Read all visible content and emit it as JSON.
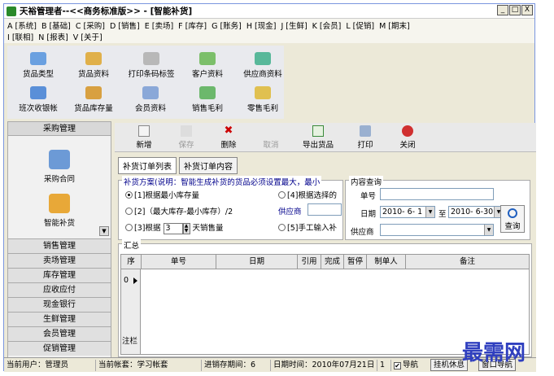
{
  "window": {
    "title": "天裕管理者--<<商务标准版>> - [智能补货]",
    "buttons": [
      "_",
      "□",
      "X"
    ]
  },
  "menu": {
    "row1": [
      "A [系统]",
      "B [基础]",
      "C [采购]",
      "D [销售]",
      "E [卖场]",
      "F [库存]",
      "G [账务]",
      "H [现金]",
      "J [生鲜]",
      "K [会员]",
      "L [促销]",
      "M [期末]"
    ],
    "row2": [
      "I [联相]",
      "N [报表]",
      "V [关于]"
    ]
  },
  "toolbox": {
    "items": [
      "货品类型",
      "货品资料",
      "打印条码标签",
      "客户资料",
      "供应商资料",
      "班次收银帐",
      "货品库存量",
      "会员资料",
      "销售毛利",
      "零售毛利"
    ]
  },
  "sidebar": {
    "header": "采购管理",
    "items": [
      "采购合同",
      "智能补货"
    ],
    "categories": [
      "销售管理",
      "卖场管理",
      "库存管理",
      "应收应付",
      "现金银行",
      "生鲜管理",
      "会员管理",
      "促销管理"
    ]
  },
  "main_toolbar": {
    "add": "新增",
    "save": "保存",
    "delete": "删除",
    "cancel": "取消",
    "export": "导出货品",
    "print": "打印",
    "close": "关闭"
  },
  "tabs": [
    "补货订单列表",
    "补货订单内容"
  ],
  "scheme": {
    "legend": "补货方案(说明：智能生成补货的货品必须设置最大，最小",
    "opt1": "[1]根据最小库存量",
    "opt2": "[2]（最大库存-最小库存）/2",
    "opt3_prefix": "[3]根据",
    "opt3_days": "3",
    "opt3_suffix": "天销售量",
    "opt4": "[4]根据选择的",
    "opt5": "[5]手工输入补",
    "supplier_label": "供应商"
  },
  "query": {
    "legend": "内容查询",
    "order_no_label": "单号",
    "date_label": "日期",
    "date_from": "2010- 6- 1",
    "to_label": "至",
    "date_to": "2010- 6-30",
    "supplier_label": "供应商",
    "query_button": "查询"
  },
  "summary": {
    "legend": "汇总",
    "columns": [
      "序",
      "单号",
      "日期",
      "引用",
      "完成",
      "暂停",
      "制单人",
      "备注"
    ],
    "row0": "0",
    "footer": "注栏"
  },
  "status": {
    "user": "当前用户：管理员",
    "book": "当前帐套：学习帐套",
    "period": "进销存期间：6",
    "datetime": "日期时间：2010年07月21日",
    "page": "1",
    "nav_checkbox": "导航",
    "hangup_button": "挂机休息",
    "window_nav_button": "窗口导航"
  },
  "watermark": "最需网"
}
